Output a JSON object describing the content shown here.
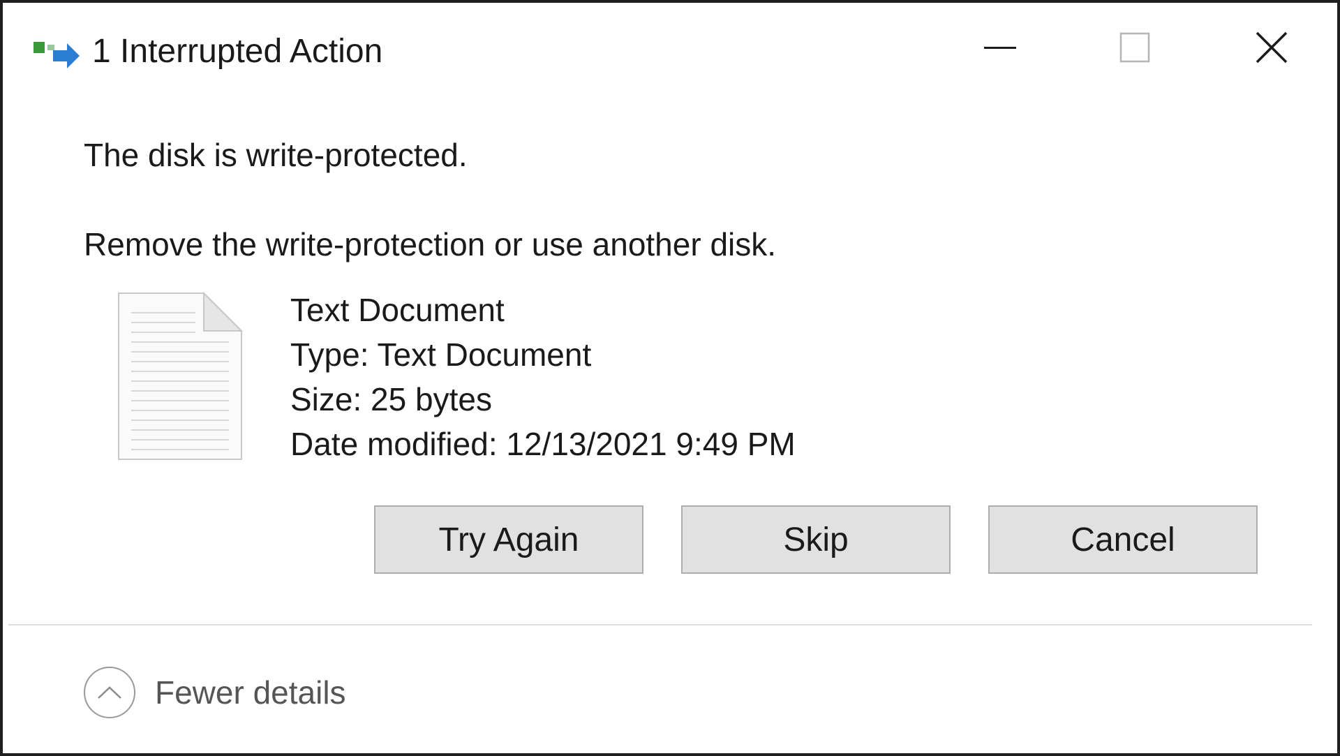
{
  "window": {
    "title": "1 Interrupted Action",
    "title_icon": "file-move-icon",
    "controls": {
      "minimize_icon": "minimize-icon",
      "maximize_icon": "maximize-icon",
      "close_icon": "close-icon"
    }
  },
  "message": {
    "headline": "The disk is write-protected.",
    "instruction": "Remove the write-protection or use another disk."
  },
  "file": {
    "icon": "text-document-icon",
    "name": "Text Document",
    "type": "Type: Text Document",
    "size": "Size: 25 bytes",
    "date_modified": "Date modified: 12/13/2021 9:49 PM"
  },
  "buttons": {
    "try_again": "Try Again",
    "skip": "Skip",
    "cancel": "Cancel"
  },
  "footer": {
    "details_toggle_label": "Fewer details",
    "details_toggle_icon": "chevron-up-icon"
  },
  "colors": {
    "button_face": "#e1e1e1",
    "button_border": "#adadad",
    "window_border": "#1f1f1f",
    "icon_green": "#3a9a3a",
    "icon_blue": "#2b7cd3"
  }
}
